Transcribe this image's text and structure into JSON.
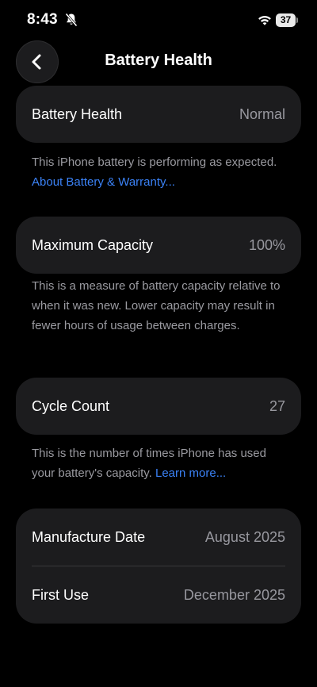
{
  "status_bar": {
    "time": "8:43",
    "battery_level": "37"
  },
  "nav": {
    "title": "Battery Health"
  },
  "battery_health": {
    "label": "Battery Health",
    "value": "Normal",
    "description": "This iPhone battery is performing as expected.",
    "link": "About Battery & Warranty..."
  },
  "maximum_capacity": {
    "label": "Maximum Capacity",
    "value": "100%",
    "description": "This is a measure of battery capacity relative to when it was new. Lower capacity may result in fewer hours of usage between charges."
  },
  "cycle_count": {
    "label": "Cycle Count",
    "value": "27",
    "description": "This is the number of times iPhone has used your battery's capacity.",
    "link": "Learn more..."
  },
  "dates": {
    "manufacture_label": "Manufacture Date",
    "manufacture_value": "August 2025",
    "first_use_label": "First Use",
    "first_use_value": "December 2025"
  },
  "colors": {
    "background": "#000000",
    "card": "#1c1c1e",
    "link": "#3b82f6",
    "secondary_text": "#98989f"
  }
}
